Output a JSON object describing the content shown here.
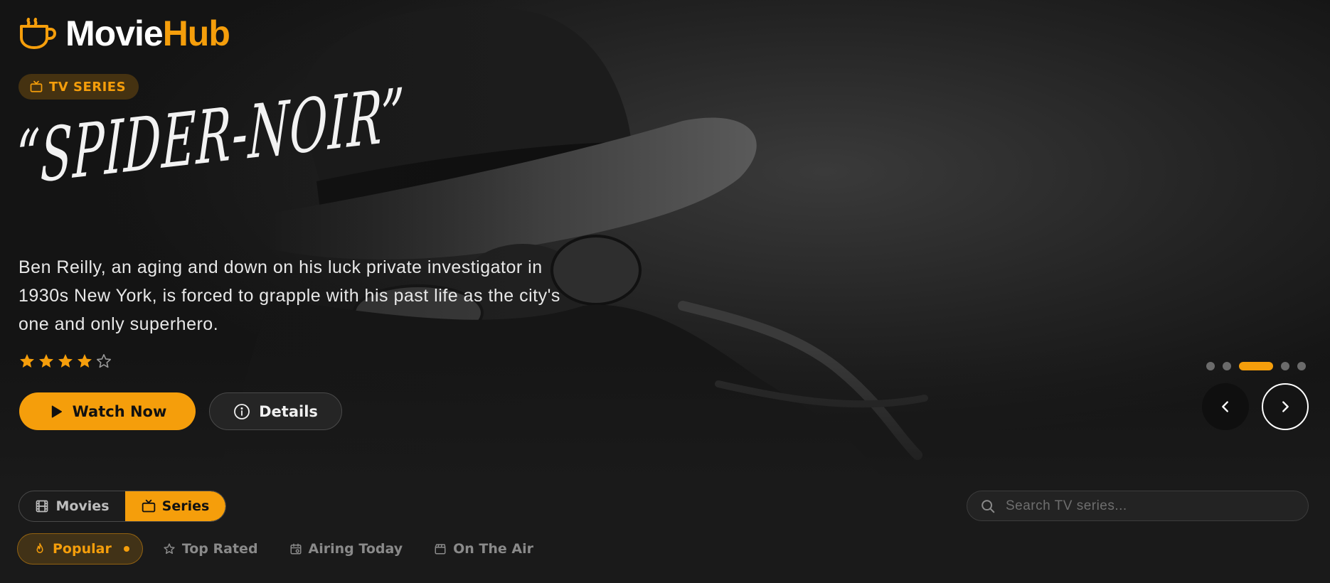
{
  "brand": {
    "name_part1": "Movie",
    "name_part2": "Hub",
    "accent": "#f59e0b"
  },
  "hero": {
    "badge": "TV SERIES",
    "title": "“SPIDER-NOIR”",
    "description": "Ben Reilly, an aging and down on his luck private investigator in 1930s New York, is forced to grapple with his past life as the city's one and only superhero.",
    "rating": {
      "value": 4,
      "max": 5
    },
    "watch_label": "Watch Now",
    "details_label": "Details"
  },
  "slider": {
    "slides": 5,
    "active_index": 2
  },
  "toggle": {
    "movies_label": "Movies",
    "series_label": "Series",
    "active": "series"
  },
  "search": {
    "placeholder": "Search TV series..."
  },
  "filters": [
    {
      "label": "Popular",
      "icon": "flame-icon",
      "active": true
    },
    {
      "label": "Top Rated",
      "icon": "star-outline-icon",
      "active": false
    },
    {
      "label": "Airing Today",
      "icon": "calendar-icon",
      "active": false
    },
    {
      "label": "On The Air",
      "icon": "clapperboard-icon",
      "active": false
    }
  ],
  "colors": {
    "background": "#1a1a1a",
    "accent": "#f59e0b",
    "muted": "#8a8a8a"
  }
}
